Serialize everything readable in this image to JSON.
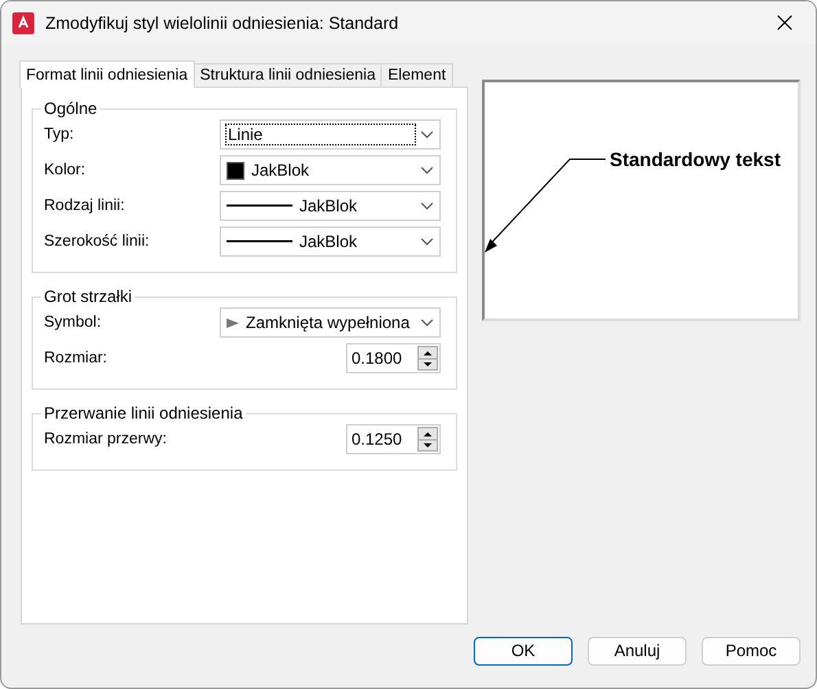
{
  "window": {
    "title": "Zmodyfikuj styl wielolinii odniesienia: Standard"
  },
  "tabs": [
    {
      "label": "Format linii odniesienia",
      "selected": true
    },
    {
      "label": "Struktura linii odniesienia",
      "selected": false
    },
    {
      "label": "Element",
      "selected": false
    }
  ],
  "groups": [
    {
      "title": "Ogólne",
      "rows": [
        {
          "label": "Typ:",
          "kind": "combo",
          "value": "Linie",
          "focused": true
        },
        {
          "label": "Kolor:",
          "kind": "combo",
          "prefix": {
            "kind": "swatch",
            "color": "#000000"
          },
          "value": "JakBlok",
          "focused": false
        },
        {
          "label": "Rodzaj linii:",
          "kind": "combo",
          "prefix": {
            "kind": "line"
          },
          "value": "JakBlok",
          "focused": false
        },
        {
          "label": "Szerokość linii:",
          "kind": "combo",
          "prefix": {
            "kind": "line"
          },
          "value": "JakBlok",
          "focused": false
        }
      ]
    },
    {
      "title": "Grot strzałki",
      "rows": [
        {
          "label": "Symbol:",
          "kind": "combo",
          "prefix": {
            "kind": "arrow"
          },
          "value": "Zamknięta wypełniona",
          "focused": false
        },
        {
          "label": "Rozmiar:",
          "kind": "spin",
          "value": "0.1800"
        }
      ]
    },
    {
      "title": "Przerwanie linii odniesienia",
      "rows": [
        {
          "label": "Rozmiar przerwy:",
          "kind": "spin",
          "value": "0.1250"
        }
      ]
    }
  ],
  "preview": {
    "text": "Standardowy tekst"
  },
  "buttons": [
    {
      "label": "OK",
      "default": true
    },
    {
      "label": "Anuluj",
      "default": false
    },
    {
      "label": "Pomoc",
      "default": false
    }
  ]
}
